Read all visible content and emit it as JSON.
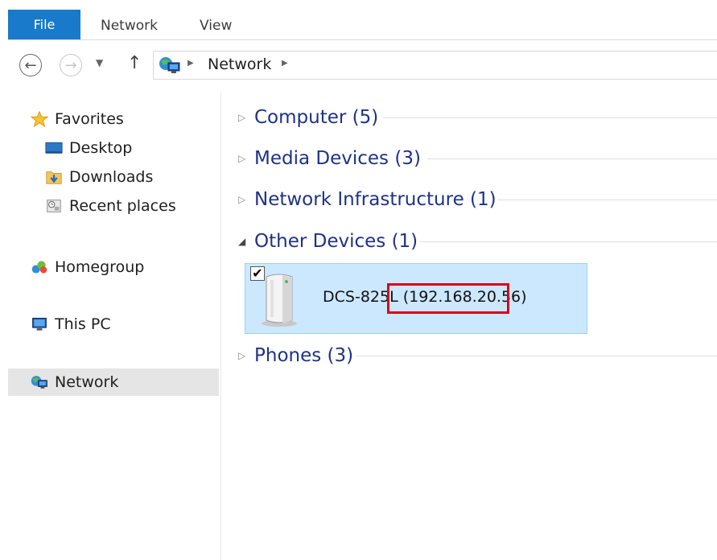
{
  "ribbon": {
    "tabs": [
      "File",
      "Network",
      "View"
    ]
  },
  "address": {
    "back_icon": "back-arrow-icon",
    "forward_icon": "forward-arrow-icon",
    "recent_icon": "chevron-down-icon",
    "up_icon": "up-arrow-icon",
    "location_icon": "network-icon",
    "path": [
      "Network"
    ]
  },
  "sidebar": {
    "favorites": {
      "label": "Favorites",
      "icon": "star-icon"
    },
    "favorite_items": [
      {
        "label": "Desktop",
        "icon": "desktop-icon"
      },
      {
        "label": "Downloads",
        "icon": "downloads-folder-icon"
      },
      {
        "label": "Recent places",
        "icon": "recent-places-icon"
      }
    ],
    "homegroup": {
      "label": "Homegroup",
      "icon": "homegroup-icon"
    },
    "this_pc": {
      "label": "This PC",
      "icon": "computer-icon"
    },
    "network": {
      "label": "Network",
      "icon": "network-icon",
      "selected": true
    }
  },
  "groups": [
    {
      "label": "Computer (5)",
      "expanded": false
    },
    {
      "label": "Media Devices (3)",
      "expanded": false
    },
    {
      "label": "Network Infrastructure (1)",
      "expanded": false
    },
    {
      "label": "Other Devices (1)",
      "expanded": true
    },
    {
      "label": "Phones (3)",
      "expanded": false
    }
  ],
  "device": {
    "name": "DCS-825L (192.168.20.56)",
    "checked": true,
    "icon": "network-device-icon"
  },
  "colors": {
    "file_tab": "#1979ca",
    "group_title": "#1e3287",
    "selection_fill": "#cce8ff",
    "highlight_box": "#d9001b"
  }
}
